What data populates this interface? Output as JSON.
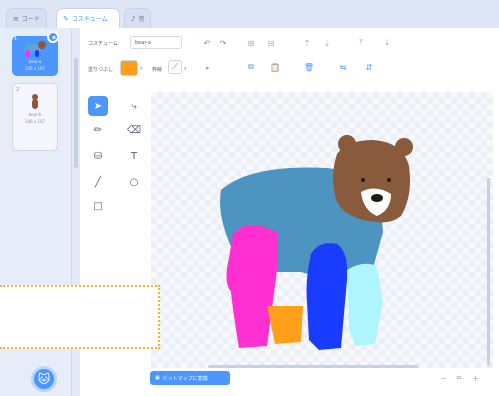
{
  "tabs": [
    {
      "label": "コード",
      "icon": "code-icon"
    },
    {
      "label": "コスチューム",
      "icon": "brush-icon"
    },
    {
      "label": "音",
      "icon": "speaker-icon"
    }
  ],
  "sprites": [
    {
      "number": "1",
      "caption1": "bear-a",
      "caption2": "106 x 107"
    },
    {
      "number": "2",
      "caption1": "bear-b",
      "caption2": "106 x 107"
    }
  ],
  "editor": {
    "costume_label": "コスチューム",
    "costume_name": "bear-a",
    "fill_label": "塗りつぶし",
    "outline_label": "枠線",
    "convert_button": "ビットマップに変換",
    "zoom_out": "－",
    "zoom_reset": "=",
    "zoom_in": "＋"
  },
  "colors": {
    "accent": "#4c97ff",
    "fill_swatch": "#ff9f1a"
  }
}
